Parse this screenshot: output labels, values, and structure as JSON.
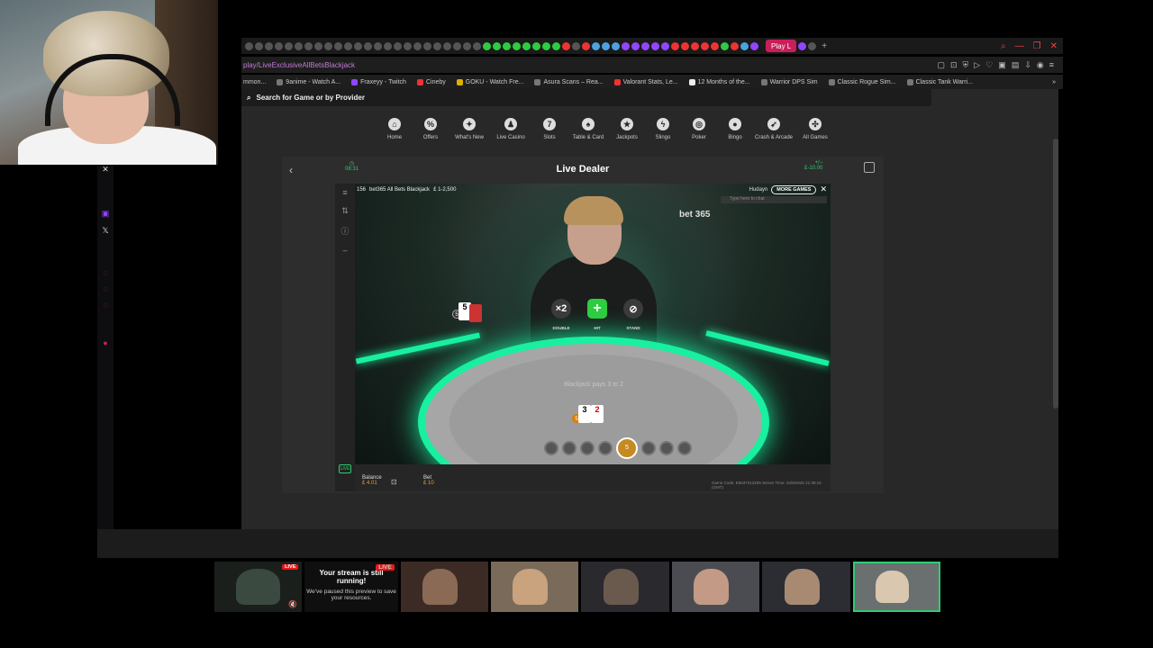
{
  "browser": {
    "active_tab_label": "Play L",
    "url": "play/LiveExclusiveAllBetsBlackjack",
    "bookmarks": [
      "mmon...",
      "9anime - Watch A...",
      "Fraxeyy - Twitch",
      "Cineby",
      "GOKU - Watch Fre...",
      "Asura Scans – Rea...",
      "Valorant Stats, Le...",
      "12 Months of the...",
      "Warrior DPS Sim",
      "Classic Rogue Sim...",
      "Classic Tank Warri..."
    ]
  },
  "page": {
    "search_placeholder": "Search for Game or by Provider",
    "nav": [
      {
        "label": "Home",
        "icon": "home-icon",
        "glyph": "⌂"
      },
      {
        "label": "Offers",
        "icon": "offers-icon",
        "glyph": "%"
      },
      {
        "label": "What's New",
        "icon": "sparkle-icon",
        "glyph": "✦"
      },
      {
        "label": "Live Casino",
        "icon": "dealer-icon",
        "glyph": "♟"
      },
      {
        "label": "Slots",
        "icon": "slots-icon",
        "glyph": "7"
      },
      {
        "label": "Table & Card",
        "icon": "card-icon",
        "glyph": "♠"
      },
      {
        "label": "Jackpots",
        "icon": "star-icon",
        "glyph": "★"
      },
      {
        "label": "Slingo",
        "icon": "bolt-icon",
        "glyph": "ϟ"
      },
      {
        "label": "Poker",
        "icon": "chip-icon",
        "glyph": "◎"
      },
      {
        "label": "Bingo",
        "icon": "bingo-icon",
        "glyph": "●"
      },
      {
        "label": "Crash & Arcade",
        "icon": "rocket-icon",
        "glyph": "➶"
      },
      {
        "label": "All Games",
        "icon": "grid-icon",
        "glyph": "✣"
      }
    ]
  },
  "game": {
    "header_title": "Live Dealer",
    "clock": "08:31",
    "stake_label": "+/−",
    "stake_value": "£-10.00",
    "table_id": "156",
    "table_name": "bet365 All Bets Blackjack",
    "limits": "£ 1-2,500",
    "username": "Hudayn",
    "more_games": "MORE GAMES",
    "chat_placeholder": "Type here to chat",
    "logo": "bet 365",
    "dealer_count": "5",
    "player_count": "5",
    "dealer_card": "5",
    "player_cards": [
      "3",
      "2"
    ],
    "felt_text": "Blackjack pays 3 to 2",
    "actions": [
      {
        "label": "DOUBLE",
        "glyph": "×2"
      },
      {
        "label": "HIT",
        "glyph": "+"
      },
      {
        "label": "STAND",
        "glyph": "⊘"
      }
    ],
    "selected_chip": "5",
    "balance_label": "Balance",
    "balance_value": "£ 4.01",
    "bet_label": "Bet",
    "bet_value": "£ 10",
    "game_code": "Game Code: E5537313209",
    "server_time": "Server Time: 22/9/2025 21:39:16 (GMT)"
  },
  "stream": {
    "live_label": "LIVE",
    "paused_title": "Your stream is still running!",
    "paused_body": "We've paused this preview to save your resources."
  },
  "colors": {
    "accent_green": "#2ecc71",
    "neon": "#18f0a0",
    "twitch_red": "#e91916"
  }
}
